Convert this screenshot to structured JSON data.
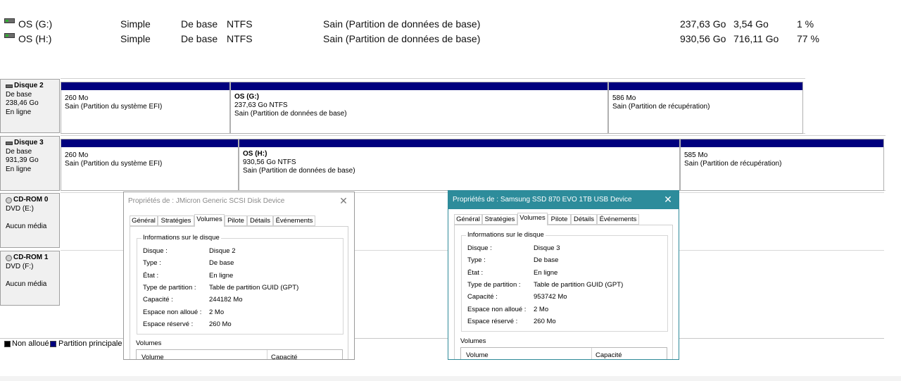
{
  "volumes": [
    {
      "name": "OS (G:)",
      "layout": "Simple",
      "type": "De base",
      "fs": "NTFS",
      "status": "Sain (Partition de données de base)",
      "capacity": "237,63 Go",
      "free": "3,54 Go",
      "pct_free": "1 %"
    },
    {
      "name": "OS (H:)",
      "layout": "Simple",
      "type": "De base",
      "fs": "NTFS",
      "status": "Sain (Partition de données de base)",
      "capacity": "930,56 Go",
      "free": "716,11 Go",
      "pct_free": "77 %"
    }
  ],
  "disks": [
    {
      "title": "Disque 2",
      "type": "De base",
      "size": "238,46 Go",
      "state": "En ligne",
      "partitions": [
        {
          "name": "",
          "size": "260 Mo",
          "status": "Sain (Partition du système EFI)"
        },
        {
          "name": "OS  (G:)",
          "size": "237,63 Go NTFS",
          "status": "Sain (Partition de données de base)"
        },
        {
          "name": "",
          "size": "586 Mo",
          "status": "Sain (Partition de récupération)"
        }
      ]
    },
    {
      "title": "Disque 3",
      "type": "De base",
      "size": "931,39 Go",
      "state": "En ligne",
      "partitions": [
        {
          "name": "",
          "size": "260 Mo",
          "status": "Sain (Partition du système EFI)"
        },
        {
          "name": "OS  (H:)",
          "size": "930,56 Go NTFS",
          "status": "Sain (Partition de données de base)"
        },
        {
          "name": "",
          "size": "585 Mo",
          "status": "Sain (Partition de récupération)"
        }
      ]
    }
  ],
  "cdroms": [
    {
      "title": "CD-ROM 0",
      "drive": "DVD (E:)",
      "media": "Aucun média"
    },
    {
      "title": "CD-ROM 1",
      "drive": "DVD (F:)",
      "media": "Aucun média"
    }
  ],
  "legend": [
    {
      "label": "Non alloué",
      "color": "#000000"
    },
    {
      "label": "Partition principale",
      "color": "#00007e"
    }
  ],
  "dialogs": [
    {
      "title": "Propriétés de : JMicron Generic SCSI Disk Device",
      "active": false,
      "tabs": [
        "Général",
        "Stratégies",
        "Volumes",
        "Pilote",
        "Détails",
        "Événements"
      ],
      "selected_tab": "Volumes",
      "group_title": "Informations sur le disque",
      "fields": [
        {
          "label": "Disque :",
          "value": "Disque 2"
        },
        {
          "label": "Type :",
          "value": "De base"
        },
        {
          "label": "État :",
          "value": "En ligne"
        },
        {
          "label": "Type de partition :",
          "value": "Table de partition GUID (GPT)"
        },
        {
          "label": "Capacité :",
          "value": "244182 Mo"
        },
        {
          "label": "Espace non alloué :",
          "value": "2 Mo"
        },
        {
          "label": "Espace réservé :",
          "value": "260 Mo"
        }
      ],
      "volumes_label": "Volumes",
      "columns": [
        "Volume",
        "Capacité"
      ]
    },
    {
      "title": "Propriétés de : Samsung SSD 870 EVO 1TB USB Device",
      "active": true,
      "tabs": [
        "Général",
        "Stratégies",
        "Volumes",
        "Pilote",
        "Détails",
        "Événements"
      ],
      "selected_tab": "Volumes",
      "group_title": "Informations sur le disque",
      "fields": [
        {
          "label": "Disque :",
          "value": "Disque 3"
        },
        {
          "label": "Type :",
          "value": "De base"
        },
        {
          "label": "État :",
          "value": "En ligne"
        },
        {
          "label": "Type de partition :",
          "value": "Table de partition GUID (GPT)"
        },
        {
          "label": "Capacité :",
          "value": "953742 Mo"
        },
        {
          "label": "Espace non alloué :",
          "value": "2 Mo"
        },
        {
          "label": "Espace réservé :",
          "value": "260 Mo"
        }
      ],
      "volumes_label": "Volumes",
      "columns": [
        "Volume",
        "Capacité"
      ]
    }
  ],
  "icons": {
    "close": "close-icon",
    "drive": "drive-icon",
    "cdrom": "cdrom-icon"
  },
  "colors": {
    "primary_partition": "#00007e",
    "active_title": "#2d8c9b"
  }
}
